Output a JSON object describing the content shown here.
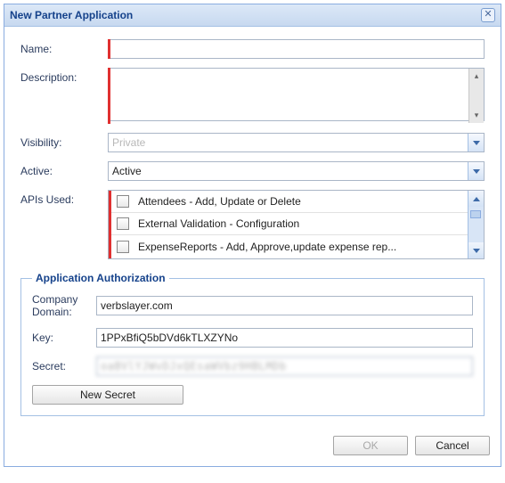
{
  "title": "New Partner Application",
  "close_glyph": "✕",
  "labels": {
    "name": "Name:",
    "description": "Description:",
    "visibility": "Visibility:",
    "active": "Active:",
    "apis": "APIs Used:"
  },
  "fields": {
    "name_value": "",
    "description_value": "",
    "visibility_value": "Private",
    "active_value": "Active"
  },
  "apis": [
    {
      "label": "Attendees - Add, Update or Delete"
    },
    {
      "label": "External Validation - Configuration"
    },
    {
      "label": "ExpenseReports - Add, Approve,update expense rep..."
    }
  ],
  "auth": {
    "legend": "Application Authorization",
    "company_domain_label": "Company Domain:",
    "company_domain_value": "verbslayer.com",
    "key_label": "Key:",
    "key_value": "1PPxBfiQ5bDVd6kTLXZYNo",
    "secret_label": "Secret:",
    "secret_masked": "oaBVlYJWvDJxQEsaWVbz9HBLMDb",
    "new_secret_label": "New Secret"
  },
  "buttons": {
    "ok": "OK",
    "cancel": "Cancel"
  }
}
